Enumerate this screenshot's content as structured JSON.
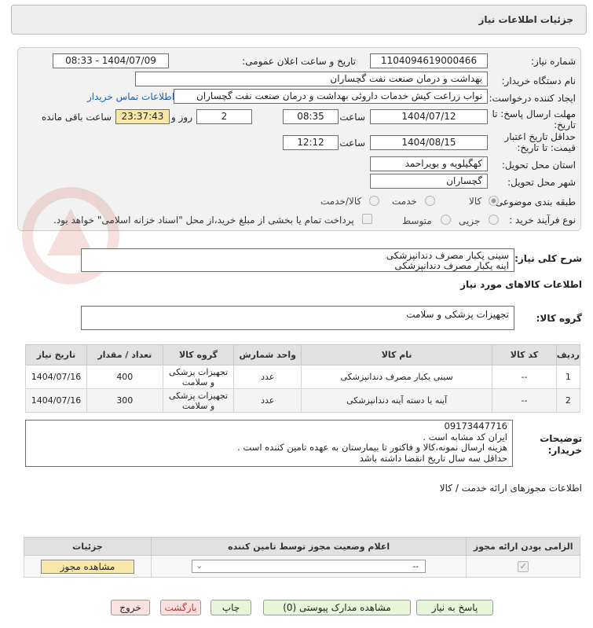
{
  "header": {
    "title": "جزئیات اطلاعات نیاز"
  },
  "form": {
    "need_number_label": "شماره نیاز:",
    "need_number": "1104094619000466",
    "announce_label": "تاریخ و ساعت اعلان عمومی:",
    "announce_value": "1404/07/09 - 08:33",
    "buyer_org_label": "نام دستگاه خریدار:",
    "buyer_org": "بهداشت و درمان صنعت نفت گچساران",
    "requester_label": "ایجاد کننده درخواست:",
    "requester": "نواب زراعت کیش خدمات داروئی بهداشت و درمان صنعت نفت گچساران",
    "contact_link": "اطلاعات تماس خریدار",
    "deadline_label_1": "مهلت ارسال پاسخ: تا",
    "deadline_label_2": "تاریخ:",
    "deadline_date": "1404/07/12",
    "time_label": "ساعت",
    "deadline_time": "08:35",
    "days_value": "2",
    "days_label": "روز و",
    "remaining_value": "23:37:43",
    "remaining_label": "ساعت باقی مانده",
    "validity_label_1": "حداقل تاریخ اعتبار",
    "validity_label_2": "قیمت: تا تاریخ:",
    "validity_date": "1404/08/15",
    "validity_time": "12:12",
    "province_label": "استان محل تحویل:",
    "province": "کهگیلویه و بویراحمد",
    "city_label": "شهر محل تحویل:",
    "city": "گچساران",
    "category_label": "طبقه بندی موضوعی:",
    "category_options": [
      "کالا",
      "خدمت",
      "کالا/خدمت"
    ],
    "process_label": "نوع فرآیند خرید :",
    "process_options": [
      "جزیی",
      "متوسط"
    ],
    "payment_note": "پرداخت تمام یا بخشی از مبلغ خرید،از محل \"اسناد خزانه اسلامی\" خواهد بود."
  },
  "summary": {
    "label": "شرح کلی نیاز:",
    "lines": [
      "سینی یکبار مصرف دندانپزشکی",
      "اینه یکبار مصرف دندانپزشکی"
    ]
  },
  "goods": {
    "section_title": "اطلاعات کالاهای مورد نیاز",
    "group_label": "گروه کالا:",
    "group_value": "تجهیزات پزشکی و سلامت",
    "columns": [
      "ردیف",
      "کد کالا",
      "نام کالا",
      "واحد شمارش",
      "گروه کالا",
      "تعداد / مقدار",
      "تاریخ نیاز"
    ],
    "rows": [
      {
        "row": "1",
        "code": "--",
        "name": "سینی یکبار مصرف دندانپزشکی",
        "unit": "عدد",
        "group": "تجهیزات پزشکی و سلامت",
        "qty": "400",
        "date": "1404/07/16"
      },
      {
        "row": "2",
        "code": "--",
        "name": "آینه یا دسته آینه دندانپزشکی",
        "unit": "عدد",
        "group": "تجهیزات پزشکی و سلامت",
        "qty": "300",
        "date": "1404/07/16"
      }
    ]
  },
  "buyer_notes": {
    "label_1": "توضیحات",
    "label_2": "خریدار:",
    "lines": [
      "09173447716",
      "ایران کد مشابه است .",
      "هزینه ارسال نمونه،کالا و فاکتور تا بیمارستان به عهده تامین کننده است .",
      "حداقل سه سال تاریخ انقضا داشته باشد"
    ]
  },
  "permits": {
    "section_title": "اطلاعات مجوزهای ارائه خدمت / کالا",
    "columns": [
      "الزامی بودن ارائه مجوز",
      "اعلام وضعیت مجوز توسط تامین کننده",
      "جزئیات"
    ],
    "select_value": "--",
    "view_button": "مشاهده مجوز"
  },
  "actions": {
    "reply": "پاسخ به نیاز",
    "view_docs": "مشاهده مدارک پیوستی (0)",
    "print": "چاپ",
    "back": "بازگشت",
    "exit": "خروج"
  },
  "colors": {
    "accent_link": "#1a5fb4",
    "time_highlight": "#f7e8a9",
    "button_green": "#e7f6d8",
    "button_pink": "#fbe0e0"
  }
}
